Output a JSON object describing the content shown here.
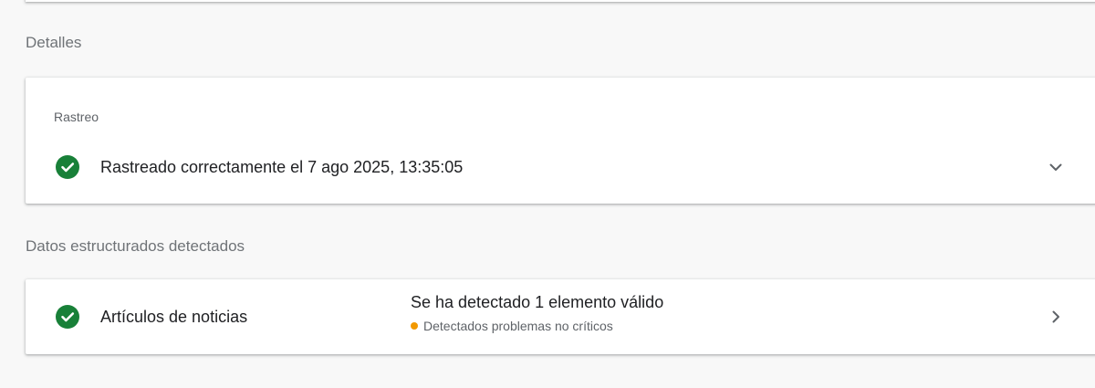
{
  "details": {
    "heading": "Detalles",
    "crawl_card": {
      "label": "Rastreo",
      "status_text": "Rastreado correctamente el 7 ago 2025, 13:35:05",
      "status_icon": "check-circle-icon",
      "expand_icon": "chevron-down-icon"
    }
  },
  "structured_data": {
    "heading": "Datos estructurados detectados",
    "items": [
      {
        "name": "Artículos de noticias",
        "status_icon": "check-circle-icon",
        "summary": "Se ha detectado 1 elemento válido",
        "warning": "Detectados problemas no críticos",
        "open_icon": "chevron-right-icon"
      }
    ]
  },
  "colors": {
    "success": "#188038",
    "warning": "#f29900",
    "background": "#f8f8f8",
    "card": "#ffffff"
  }
}
